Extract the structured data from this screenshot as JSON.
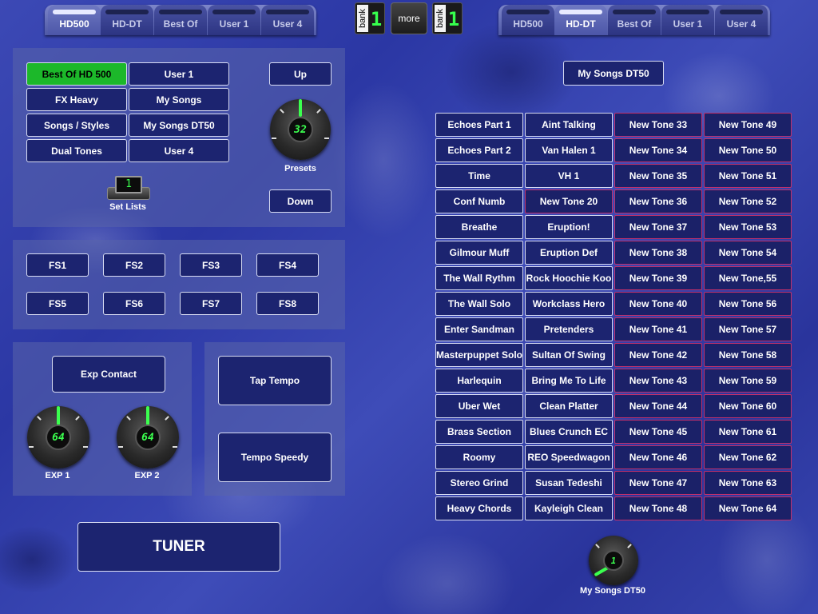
{
  "tabs_left": [
    {
      "label": "HD500",
      "active": true
    },
    {
      "label": "HD-DT",
      "active": false
    },
    {
      "label": "Best Of",
      "active": false
    },
    {
      "label": "User 1",
      "active": false
    },
    {
      "label": "User 4",
      "active": false
    }
  ],
  "tabs_right": [
    {
      "label": "HD500",
      "active": false
    },
    {
      "label": "HD-DT",
      "active": true
    },
    {
      "label": "Best Of",
      "active": false
    },
    {
      "label": "User 1",
      "active": false
    },
    {
      "label": "User 4",
      "active": false
    }
  ],
  "bank_left": {
    "label": "bank",
    "value": "1"
  },
  "bank_right": {
    "label": "bank",
    "value": "1"
  },
  "more_label": "more",
  "preset_lists": [
    "Best Of HD 500",
    "User 1",
    "FX Heavy",
    "My Songs",
    "Songs / Styles",
    "My Songs DT50",
    "Dual Tones",
    "User 4"
  ],
  "up_label": "Up",
  "down_label": "Down",
  "presets_knob": {
    "value": "32",
    "label": "Presets"
  },
  "set_lists": {
    "label": "Set Lists",
    "value": "1"
  },
  "footswitches": [
    "FS1",
    "FS2",
    "FS3",
    "FS4",
    "FS5",
    "FS6",
    "FS7",
    "FS8"
  ],
  "exp_contact_label": "Exp Contact",
  "exp1": {
    "value": "64",
    "label": "EXP 1"
  },
  "exp2": {
    "value": "64",
    "label": "EXP 2"
  },
  "tap_tempo_label": "Tap Tempo",
  "tempo_speedy_label": "Tempo Speedy",
  "tuner_label": "TUNER",
  "right_title": "My Songs DT50",
  "tones": [
    [
      "Echoes Part 1",
      "Aint Talking",
      "New Tone 33",
      "New Tone 49"
    ],
    [
      "Echoes Part 2",
      "Van Halen 1",
      "New Tone 34",
      "New Tone 50"
    ],
    [
      "Time",
      "VH 1",
      "New Tone 35",
      "New Tone 51"
    ],
    [
      "Conf Numb",
      "New Tone 20",
      "New Tone 36",
      "New Tone 52"
    ],
    [
      "Breathe",
      "Eruption!",
      "New Tone 37",
      "New Tone 53"
    ],
    [
      "Gilmour Muff",
      "Eruption Def",
      "New Tone 38",
      "New Tone 54"
    ],
    [
      "The Wall Rythm",
      "Rock Hoochie Koo",
      "New Tone 39",
      "New Tone,55"
    ],
    [
      "The Wall Solo",
      "Workclass Hero",
      "New Tone 40",
      "New Tone 56"
    ],
    [
      "Enter Sandman",
      "Pretenders",
      "New Tone 41",
      "New Tone 57"
    ],
    [
      "Masterpuppet Solo",
      "Sultan Of Swing",
      "New Tone 42",
      "New Tone 58"
    ],
    [
      "Harlequin",
      "Bring Me To Life",
      "New Tone 43",
      "New Tone 59"
    ],
    [
      "Uber Wet",
      "Clean Platter",
      "New Tone 44",
      "New Tone 60"
    ],
    [
      "Brass Section",
      "Blues Crunch EC",
      "New Tone 45",
      "New Tone 61"
    ],
    [
      "Roomy",
      "REO Speedwagon",
      "New Tone 46",
      "New Tone 62"
    ],
    [
      "Stereo Grind",
      "Susan Tedeshi",
      "New Tone 47",
      "New Tone 63"
    ],
    [
      "Heavy Chords",
      "Kayleigh Clean",
      "New Tone 48",
      "New Tone 64"
    ]
  ],
  "bottom_knob": {
    "value": "1",
    "label": "My Songs DT50"
  },
  "colors": {
    "accent_green": "#1cb82a",
    "led_green": "#3bff4f",
    "button_bg": "#1c2470",
    "new_tone_border": "#c0306a"
  }
}
